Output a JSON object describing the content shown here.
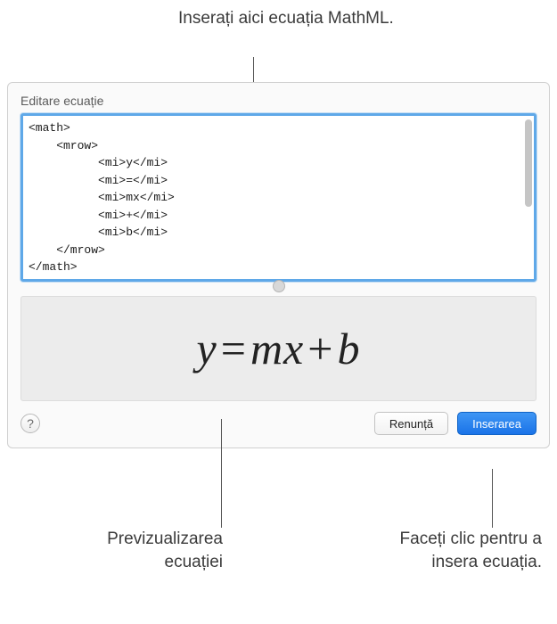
{
  "callouts": {
    "top": "Inserați aici ecuația MathML.",
    "bottom_left": "Previzualizarea ecuației",
    "bottom_right": "Faceți clic pentru a insera ecuația."
  },
  "panel": {
    "title": "Editare ecuație",
    "editor_content": "<math>\n    <mrow>\n          <mi>y</mi>\n          <mi>=</mi>\n          <mi>mx</mi>\n          <mi>+</mi>\n          <mi>b</mi>\n    </mrow>\n</math>",
    "preview": {
      "y": "y",
      "eq": "=",
      "mx": "mx",
      "plus": "+",
      "b": "b"
    },
    "buttons": {
      "help": "?",
      "cancel": "Renunță",
      "insert": "Inserarea"
    }
  }
}
